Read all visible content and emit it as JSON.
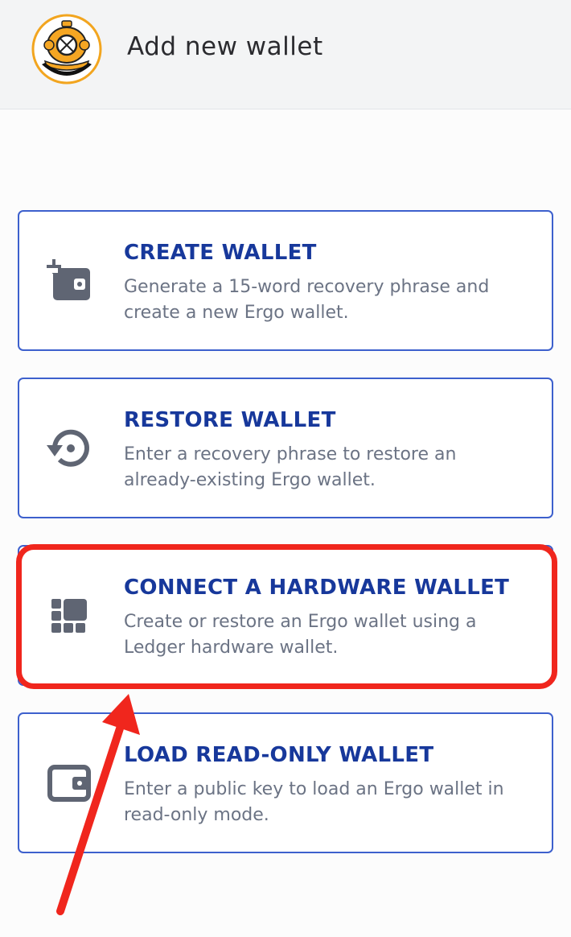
{
  "header": {
    "title": "Add new wallet",
    "logo_icon": "diving-helmet-logo"
  },
  "options": [
    {
      "title": "CREATE WALLET",
      "description": "Generate a 15-word recovery phrase and create a new Ergo wallet.",
      "icon": "wallet-plus-icon"
    },
    {
      "title": "RESTORE WALLET",
      "description": "Enter a recovery phrase to restore an already-existing Ergo wallet.",
      "icon": "restore-icon"
    },
    {
      "title": "CONNECT A HARDWARE WALLET",
      "description": "Create or restore an Ergo wallet using a Ledger hardware wallet.",
      "icon": "hardware-wallet-icon"
    },
    {
      "title": "LOAD READ-ONLY WALLET",
      "description": "Enter a public key to load an Ergo wallet in read-only mode.",
      "icon": "wallet-icon"
    }
  ],
  "colors": {
    "accent_border": "#3d60cd",
    "title_text": "#17389b",
    "description_text": "#6b7384",
    "icon": "#5f6573",
    "annotation_red": "#f0261d",
    "logo_orange": "#f5a623"
  }
}
